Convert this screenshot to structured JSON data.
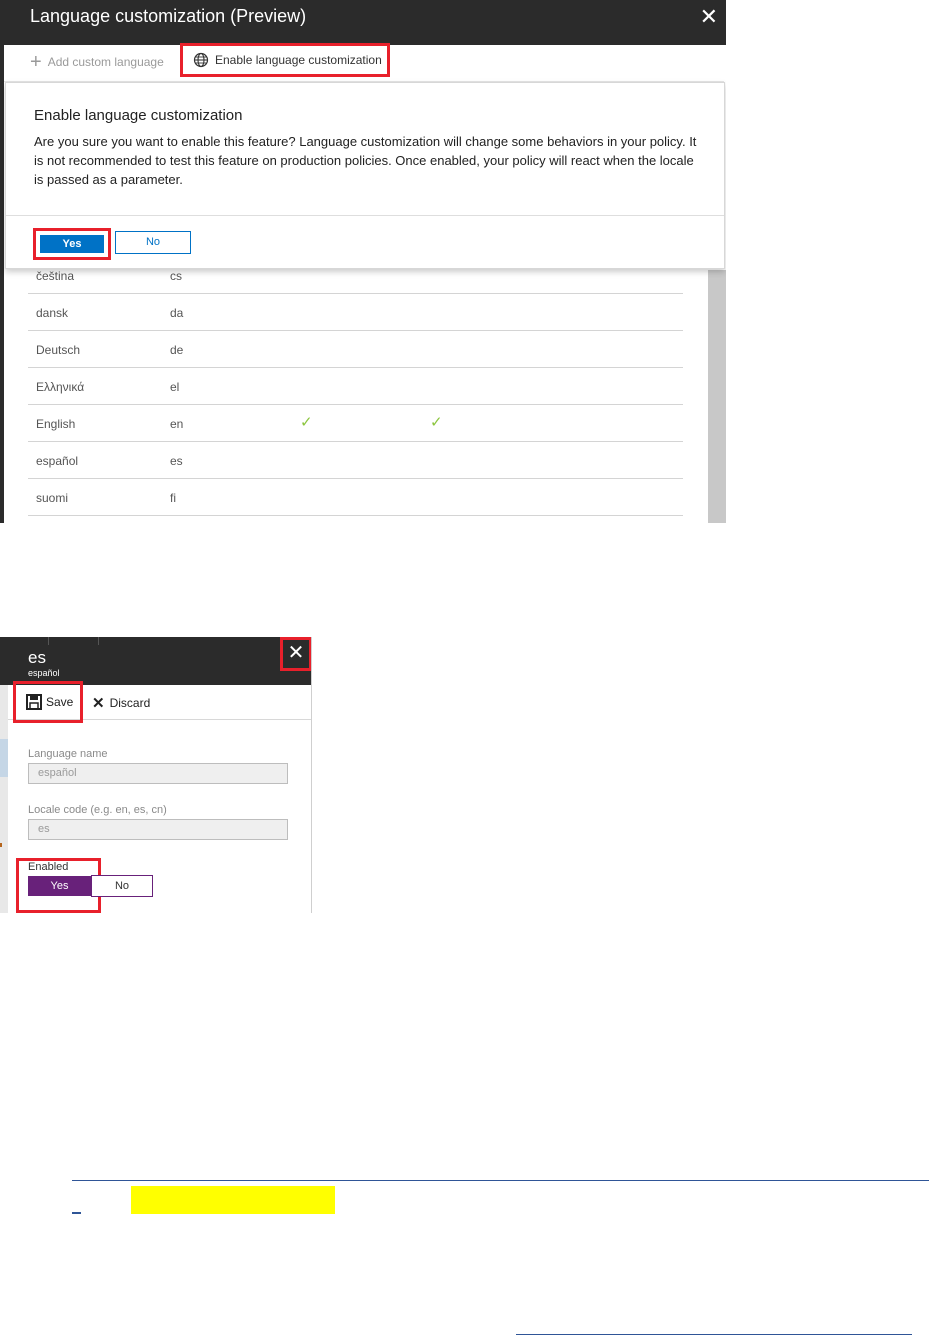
{
  "shot1": {
    "window_title": "Language customization (Preview)",
    "close_glyph": "✕",
    "toolbar": {
      "add_label": "Add custom language",
      "enable_label": "Enable language customization"
    },
    "dialog": {
      "title": "Enable language customization",
      "body": "Are you sure you want to enable this feature? Language customization will change some behaviors in your policy. It is not recommended to test this feature on production policies. Once enabled, your policy will react when the locale is passed as a parameter.",
      "yes_label": "Yes",
      "no_label": "No"
    },
    "languages": [
      {
        "name": "čeština",
        "code": "cs",
        "check1": "",
        "check2": ""
      },
      {
        "name": "dansk",
        "code": "da",
        "check1": "",
        "check2": ""
      },
      {
        "name": "Deutsch",
        "code": "de",
        "check1": "",
        "check2": ""
      },
      {
        "name": "Ελληνικά",
        "code": "el",
        "check1": "",
        "check2": ""
      },
      {
        "name": "English",
        "code": "en",
        "check1": "✓",
        "check2": "✓"
      },
      {
        "name": "español",
        "code": "es",
        "check1": "",
        "check2": ""
      },
      {
        "name": "suomi",
        "code": "fi",
        "check1": "",
        "check2": ""
      }
    ]
  },
  "shot2": {
    "title": "es",
    "subtitle": "español",
    "close_glyph": "✕",
    "save_label": "Save",
    "discard_label": "Discard",
    "language_name_label": "Language name",
    "language_name_value": "español",
    "locale_code_label": "Locale code (e.g. en, es, cn)",
    "locale_code_value": "es",
    "enabled_label": "Enabled",
    "yes_label": "Yes",
    "no_label": "No"
  },
  "colors": {
    "highlight_box": "#e8202b",
    "primary_blue": "#0072c6",
    "purple": "#68217a",
    "check_green": "#8cc63f",
    "yellow_highlight": "#ffff00"
  }
}
